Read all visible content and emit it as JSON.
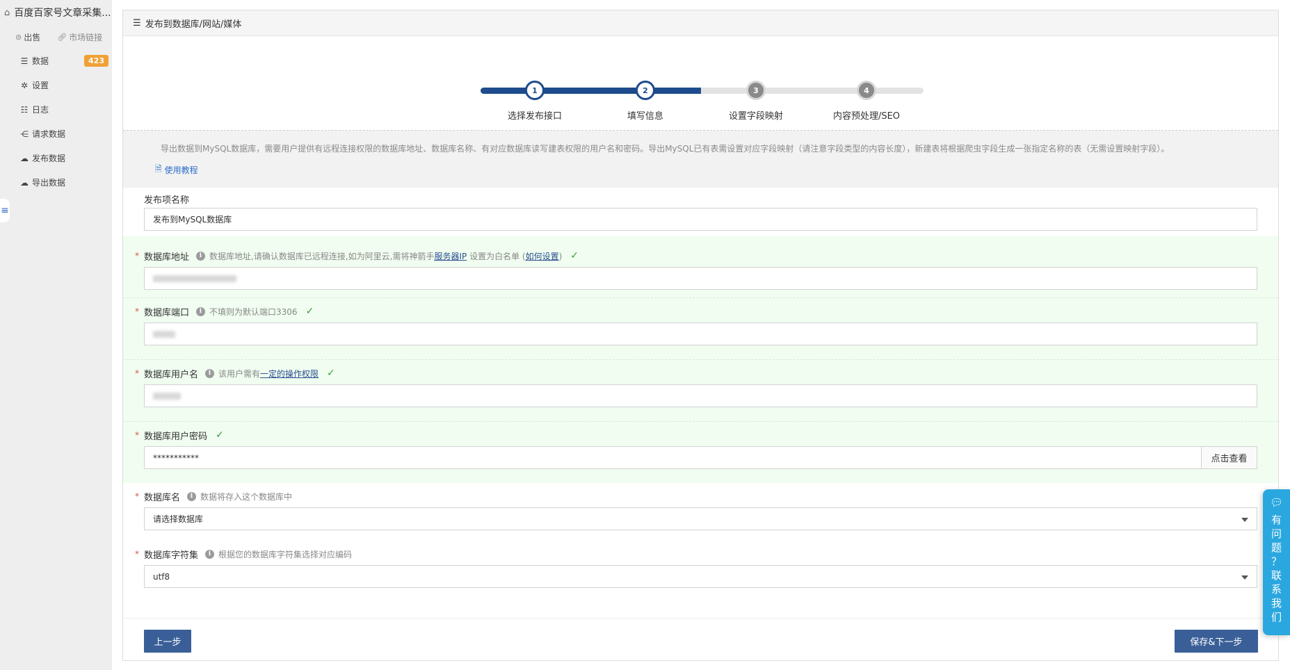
{
  "sidebar": {
    "app_title": "百度百家号文章采集...",
    "sub": [
      {
        "icon": "sell-icon",
        "label": "出售"
      },
      {
        "icon": "link-icon",
        "label": "市场链接"
      }
    ],
    "items": [
      {
        "icon": "database-icon",
        "label": "数据",
        "badge": "423"
      },
      {
        "icon": "gear-icon",
        "label": "设置"
      },
      {
        "icon": "list-icon",
        "label": "日志"
      },
      {
        "icon": "share-icon",
        "label": "请求数据"
      },
      {
        "icon": "cloud-upload-icon",
        "label": "发布数据"
      },
      {
        "icon": "cloud-export-icon",
        "label": "导出数据"
      }
    ]
  },
  "panel": {
    "title": "发布到数据库/网站/媒体"
  },
  "steps": [
    {
      "num": "1",
      "label": "选择发布接口",
      "state": "done"
    },
    {
      "num": "2",
      "label": "填写信息",
      "state": "done"
    },
    {
      "num": "3",
      "label": "设置字段映射",
      "state": "todo"
    },
    {
      "num": "4",
      "label": "内容预处理/SEO",
      "state": "todo"
    }
  ],
  "info": {
    "text": "导出数据到MySQL数据库，需要用户提供有远程连接权限的数据库地址、数据库名称、有对应数据库读写建表权限的用户名和密码。导出MySQL已有表需设置对应字段映射（请注意字段类型的内容长度），新建表将根据爬虫字段生成一张指定名称的表（无需设置映射字段）。",
    "tutorial": "使用教程"
  },
  "form": {
    "name": {
      "label": "发布项名称",
      "value": "发布到MySQL数据库"
    },
    "host": {
      "label": "数据库地址",
      "hint": "数据库地址,请确认数据库已远程连接,如为阿里云,需将神箭手",
      "link1": "服务器IP",
      "hint2": "设置为白名单 (",
      "link2": "如何设置",
      "hint3": ")"
    },
    "port": {
      "label": "数据库端口",
      "hint": "不填则为默认端口3306"
    },
    "user": {
      "label": "数据库用户名",
      "hint": "该用户需有",
      "link": "一定的操作权限"
    },
    "password": {
      "label": "数据库用户密码",
      "value": "***********",
      "button": "点击查看"
    },
    "dbname": {
      "label": "数据库名",
      "hint": "数据将存入这个数据库中",
      "value": "请选择数据库"
    },
    "charset": {
      "label": "数据库字符集",
      "hint": "根据您的数据库字符集选择对应编码",
      "value": "utf8"
    }
  },
  "buttons": {
    "prev": "上一步",
    "next": "保存&下一步"
  },
  "help": {
    "chars": [
      "有",
      "问",
      "题",
      "？",
      "联",
      "系",
      "我",
      "们"
    ]
  },
  "colors": {
    "primary": "#1e4b8c",
    "button": "#3a5f98",
    "badge": "#f0a135",
    "help": "#2ba7df",
    "success": "#3a9a3a"
  }
}
